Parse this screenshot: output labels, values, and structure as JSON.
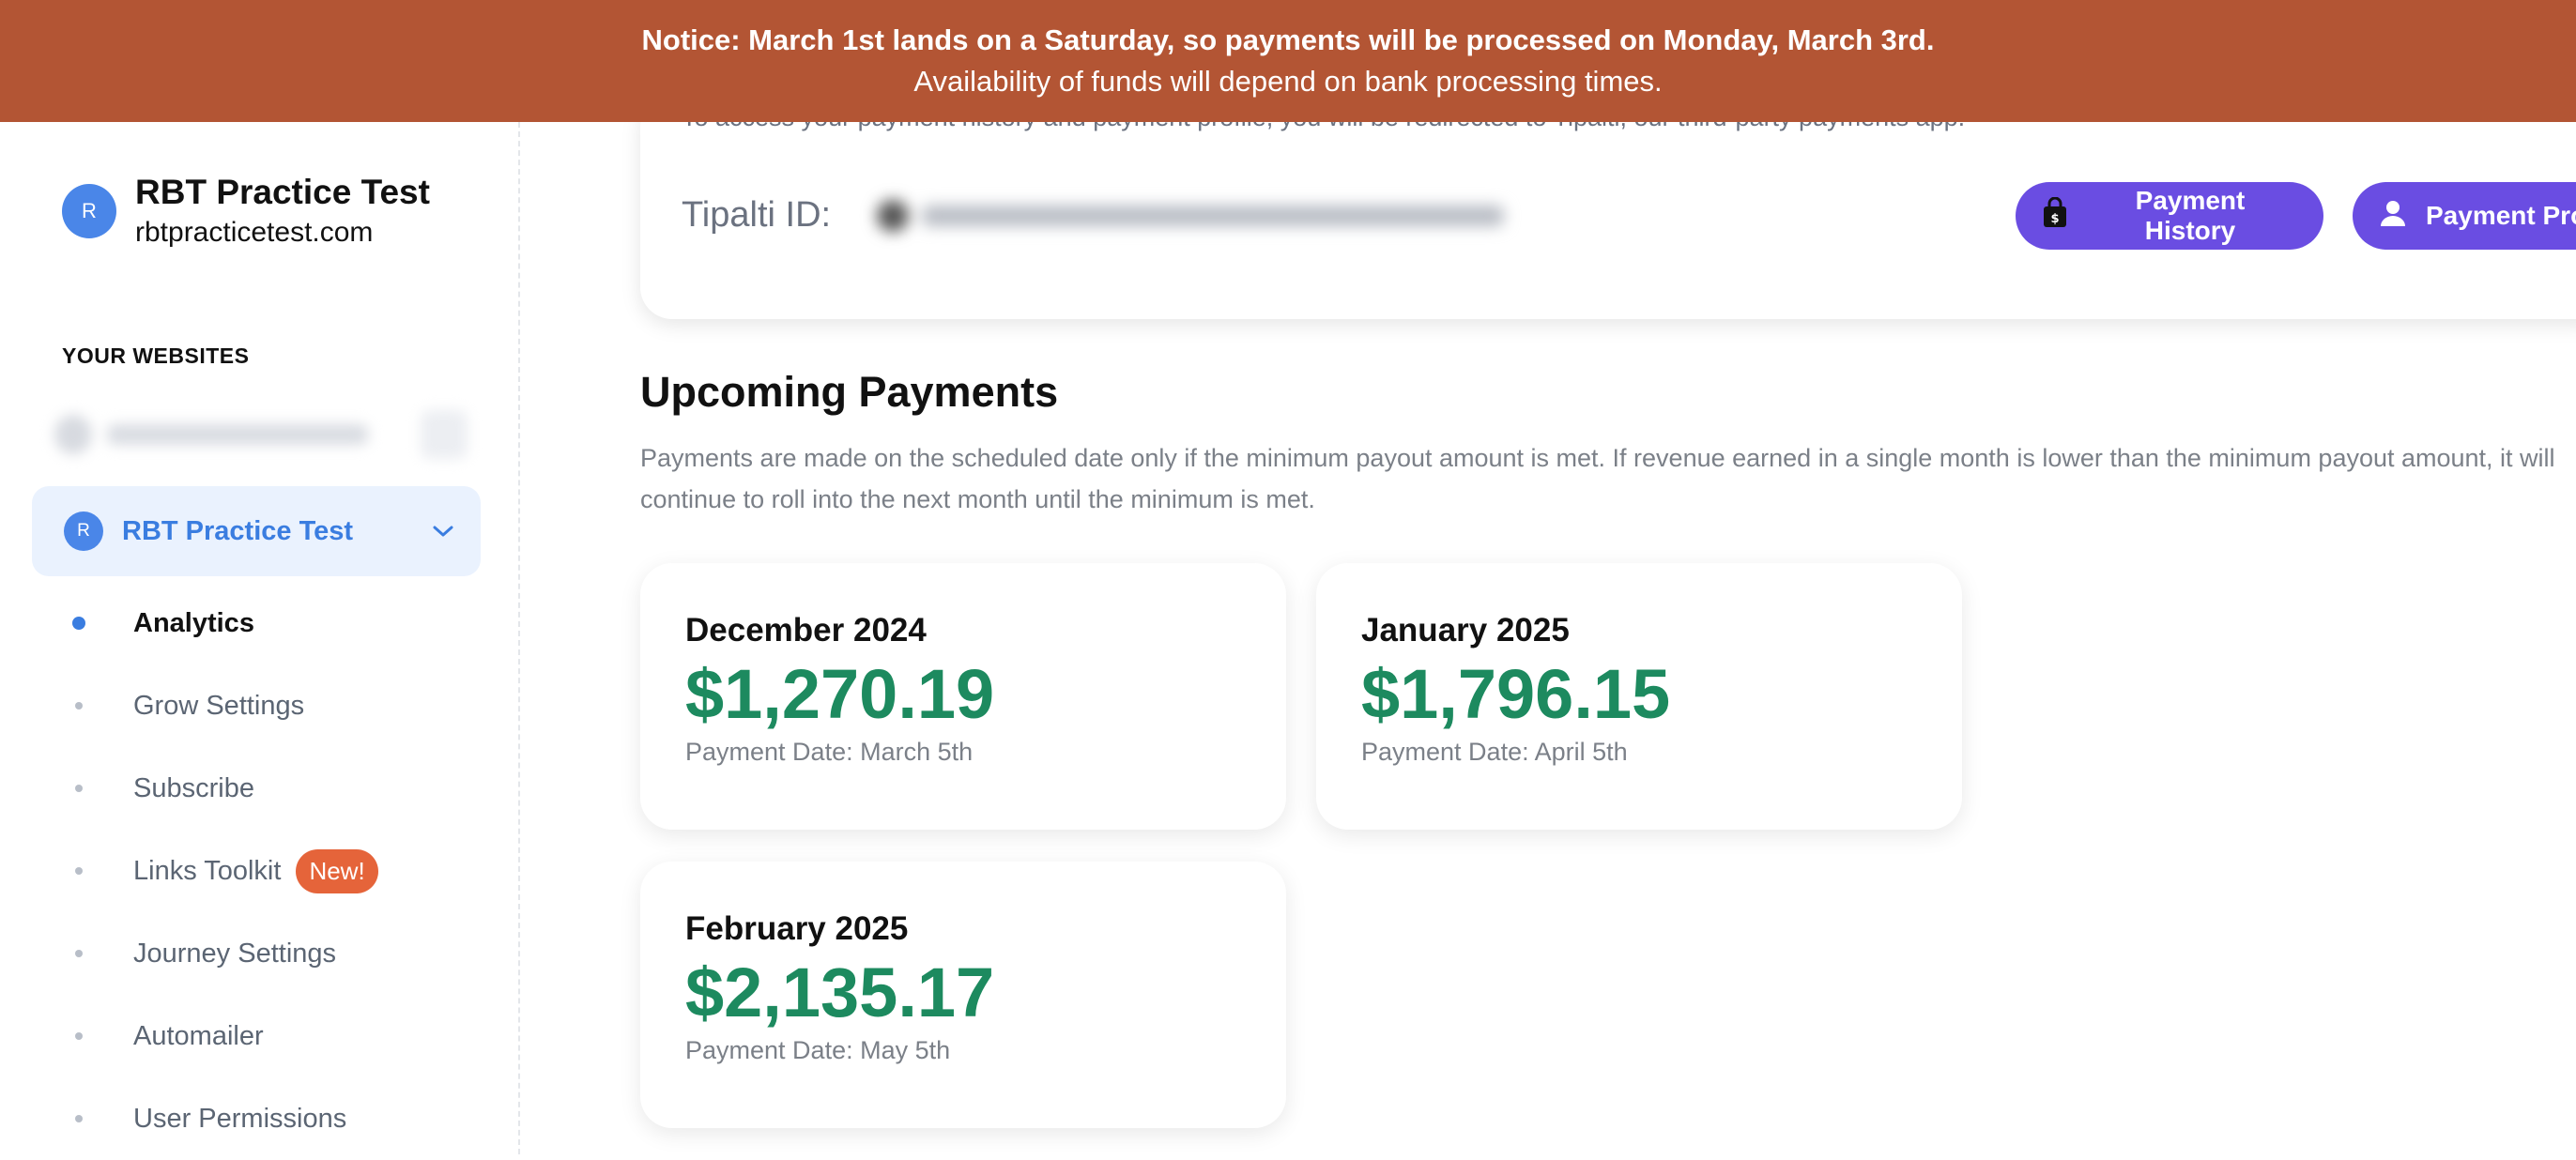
{
  "notice": {
    "line1": "Notice: March 1st lands on a Saturday, so payments will be processed on Monday, March 3rd.",
    "line2": "Availability of funds will depend on bank processing times."
  },
  "sidebar": {
    "site_initial": "R",
    "site_title": "RBT Practice Test",
    "site_domain": "rbtpracticetest.com",
    "section_label": "YOUR WEBSITES",
    "active_site": {
      "initial": "R",
      "name": "RBT Practice Test"
    },
    "nav_items": [
      {
        "label": "Analytics",
        "active": true
      },
      {
        "label": "Grow Settings"
      },
      {
        "label": "Subscribe"
      },
      {
        "label": "Links Toolkit",
        "badge": "New!"
      },
      {
        "label": "Journey Settings"
      },
      {
        "label": "Automailer"
      },
      {
        "label": "User Permissions"
      }
    ]
  },
  "tipalti": {
    "description": "To access your payment history and payment profile, you will be redirected to Tipalti, our third-party payments app.",
    "id_label": "Tipalti ID:",
    "history_button": "Payment History",
    "profile_button": "Payment Profile"
  },
  "upcoming": {
    "title": "Upcoming Payments",
    "description": "Payments are made on the scheduled date only if the minimum payout amount is met. If revenue earned in a single month is lower than the minimum payout amount, it will continue to roll into the next month until the minimum is met.",
    "payments": [
      {
        "month": "December 2024",
        "amount": "$1,270.19",
        "date": "Payment Date: March 5th"
      },
      {
        "month": "January 2025",
        "amount": "$1,796.15",
        "date": "Payment Date: April 5th"
      },
      {
        "month": "February 2025",
        "amount": "$2,135.17",
        "date": "Payment Date: May 5th"
      }
    ]
  },
  "colors": {
    "banner": "#b35534",
    "accent_blue": "#3a7de0",
    "button_purple": "#6a4de2",
    "amount_green": "#1d8a5f",
    "badge_orange": "#e5643a"
  }
}
